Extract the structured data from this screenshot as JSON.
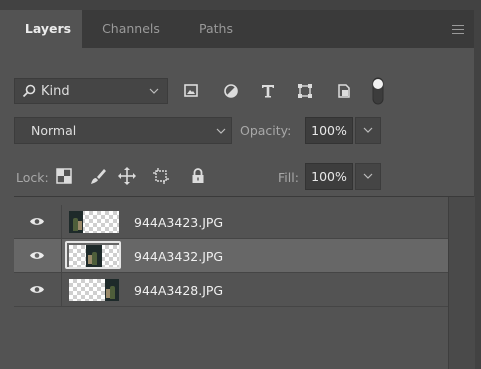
{
  "tabs": [
    {
      "label": "Layers",
      "active": true
    },
    {
      "label": "Channels",
      "active": false
    },
    {
      "label": "Paths",
      "active": false
    }
  ],
  "filter": {
    "kind_label": "Kind",
    "icons": [
      "image-filter-icon",
      "adjustment-filter-icon",
      "type-filter-icon",
      "shape-filter-icon",
      "smart-object-filter-icon",
      "filter-toggle-icon"
    ]
  },
  "blend": {
    "mode": "Normal",
    "opacity_label": "Opacity:",
    "opacity_value": "100%"
  },
  "lock": {
    "label": "Lock:",
    "icons": [
      "lock-transparent-pixels-icon",
      "lock-image-pixels-icon",
      "lock-position-icon",
      "lock-artboard-icon",
      "lock-all-icon"
    ],
    "fill_label": "Fill:",
    "fill_value": "100%"
  },
  "layers": [
    {
      "name": "944A3423.JPG",
      "visible": true,
      "selected": false
    },
    {
      "name": "944A3432.JPG",
      "visible": true,
      "selected": true
    },
    {
      "name": "944A3428.JPG",
      "visible": true,
      "selected": false
    }
  ],
  "colors": {
    "panel_bg": "#535353",
    "tab_bar_bg": "#3a3a3a",
    "selected_row": "#676767",
    "text": "#f0f0f0"
  }
}
